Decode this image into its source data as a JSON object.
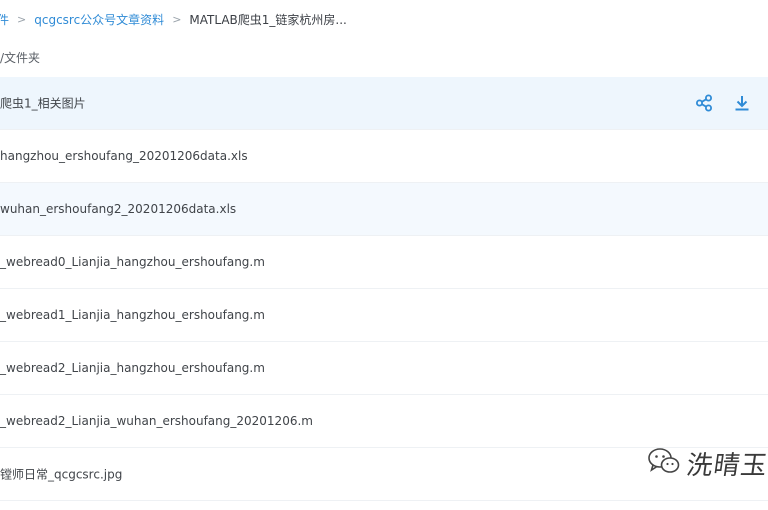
{
  "breadcrumb": {
    "items": [
      {
        "label": "件",
        "kind": "link"
      },
      {
        "label": "qcgcsrc公众号文章资料",
        "kind": "link"
      },
      {
        "label": "MATLAB爬虫1_链家杭州房...",
        "kind": "current"
      }
    ],
    "separator": ">"
  },
  "folder_header": {
    "label": "/文件夹"
  },
  "files": [
    {
      "name": "爬虫1_相关图片",
      "state": "selected"
    },
    {
      "name": "hangzhou_ershoufang_20201206data.xls",
      "state": "normal"
    },
    {
      "name": "wuhan_ershoufang2_20201206data.xls",
      "state": "hover"
    },
    {
      "name": "_webread0_Lianjia_hangzhou_ershoufang.m",
      "state": "normal"
    },
    {
      "name": "_webread1_Lianjia_hangzhou_ershoufang.m",
      "state": "normal"
    },
    {
      "name": "_webread2_Lianjia_hangzhou_ershoufang.m",
      "state": "normal"
    },
    {
      "name": "_webread2_Lianjia_wuhan_ershoufang_20201206.m",
      "state": "normal"
    },
    {
      "name": "镗师日常_qcgcsrc.jpg",
      "state": "normal"
    }
  ],
  "row_actions": {
    "share_icon": "share-icon",
    "download_icon": "download-icon"
  },
  "watermark": {
    "text": "洗晴玉",
    "icon": "wechat-icon"
  },
  "colors": {
    "accent": "#2f8bd6",
    "selected_row": "#eef6fd",
    "hover_row": "#f4f9fe"
  }
}
